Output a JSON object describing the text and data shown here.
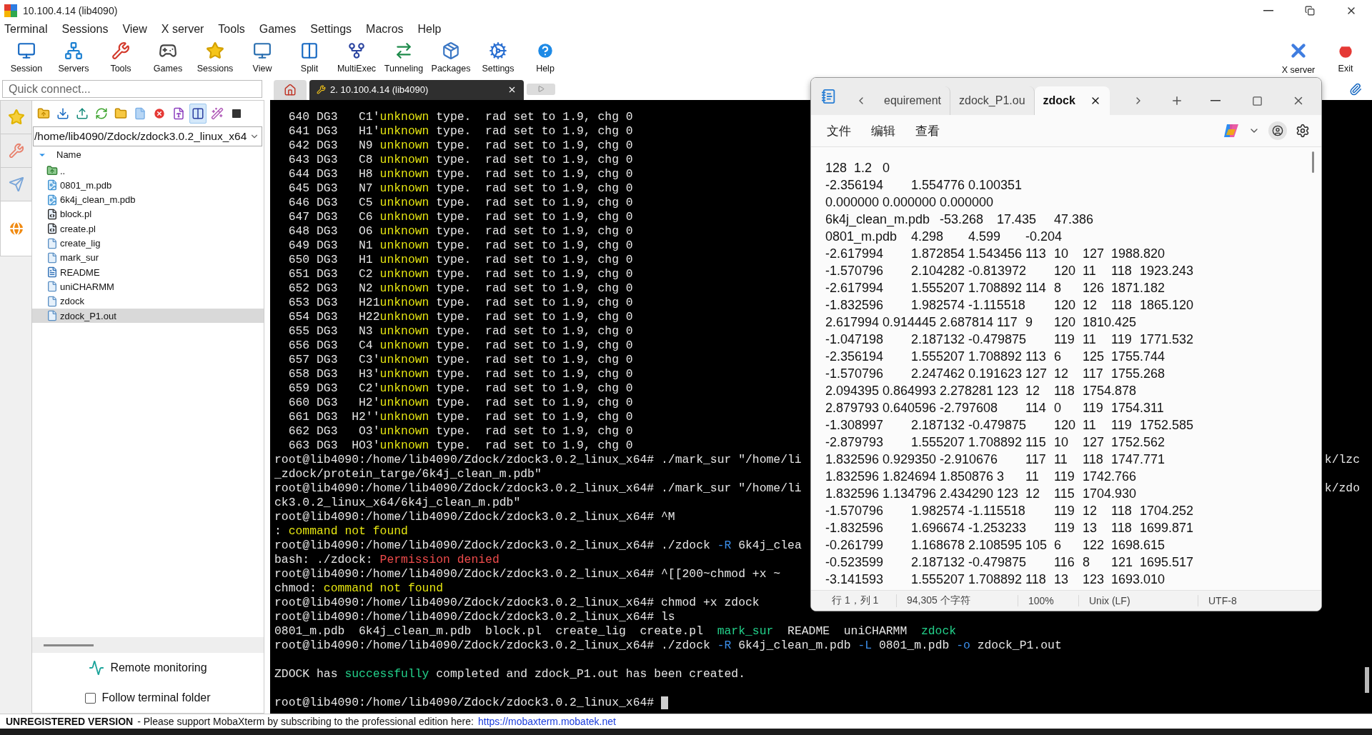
{
  "window": {
    "title": "10.100.4.14 (lib4090)"
  },
  "menu": [
    "Terminal",
    "Sessions",
    "View",
    "X server",
    "Tools",
    "Games",
    "Settings",
    "Macros",
    "Help"
  ],
  "toolbar": {
    "left": [
      "Session",
      "Servers",
      "Tools",
      "Games",
      "Sessions",
      "View",
      "Split",
      "MultiExec",
      "Tunneling",
      "Packages",
      "Settings",
      "Help"
    ],
    "right": [
      "X server",
      "Exit"
    ]
  },
  "quick_connect": {
    "placeholder": "Quick connect..."
  },
  "session_tabs": [
    {
      "kind": "home",
      "selected": false
    },
    {
      "kind": "session",
      "label": "2. 10.100.4.14 (lib4090)",
      "selected": true
    },
    {
      "kind": "new",
      "selected": false
    }
  ],
  "sidebar": {
    "tabs": [
      {
        "selected": false
      },
      {
        "selected": false
      },
      {
        "selected": false
      },
      {
        "selected": true
      }
    ],
    "toolbar": [
      {
        "selected": false
      },
      {
        "selected": false
      },
      {
        "selected": false
      },
      {
        "selected": false
      },
      {
        "selected": false
      },
      {
        "selected": false
      },
      {
        "selected": false
      },
      {
        "selected": false
      },
      {
        "selected": true
      },
      {
        "selected": false
      },
      {
        "selected": false
      }
    ],
    "path": "/home/lib4090/Zdock/zdock3.0.2_linux_x64",
    "column": "Name",
    "files": [
      {
        "name": "..",
        "kind": "parent",
        "selected": false
      },
      {
        "name": "0801_m.pdb",
        "kind": "pdb",
        "selected": false
      },
      {
        "name": "6k4j_clean_m.pdb",
        "kind": "pdb",
        "selected": false
      },
      {
        "name": "block.pl",
        "kind": "script",
        "selected": false
      },
      {
        "name": "create.pl",
        "kind": "script",
        "selected": false
      },
      {
        "name": "create_lig",
        "kind": "file",
        "selected": false
      },
      {
        "name": "mark_sur",
        "kind": "file",
        "selected": false
      },
      {
        "name": "README",
        "kind": "text",
        "selected": false
      },
      {
        "name": "uniCHARMM",
        "kind": "file",
        "selected": false
      },
      {
        "name": "zdock",
        "kind": "file",
        "selected": false
      },
      {
        "name": "zdock_P1.out",
        "kind": "file",
        "selected": true
      }
    ],
    "remote_monitoring": "Remote monitoring",
    "follow_terminal_folder": {
      "label": "Follow terminal folder",
      "checked": false
    }
  },
  "terminal": {
    "lines": [
      {
        "kind": "text",
        "parts": [
          {
            "text": "  640 DG3   C1'",
            "kind": "plain"
          },
          {
            "text": "unknown",
            "kind": "warning"
          },
          {
            "text": " type.  rad set to 1.9, chg 0",
            "kind": "plain"
          }
        ]
      },
      {
        "kind": "text",
        "parts": [
          {
            "text": "  641 DG3   H1'",
            "kind": "plain"
          },
          {
            "text": "unknown",
            "kind": "warning"
          },
          {
            "text": " type.  rad set to 1.9, chg 0",
            "kind": "plain"
          }
        ]
      },
      {
        "kind": "text",
        "parts": [
          {
            "text": "  642 DG3   N9 ",
            "kind": "plain"
          },
          {
            "text": "unknown",
            "kind": "warning"
          },
          {
            "text": " type.  rad set to 1.9, chg 0",
            "kind": "plain"
          }
        ]
      },
      {
        "kind": "text",
        "parts": [
          {
            "text": "  643 DG3   C8 ",
            "kind": "plain"
          },
          {
            "text": "unknown",
            "kind": "warning"
          },
          {
            "text": " type.  rad set to 1.9, chg 0",
            "kind": "plain"
          }
        ]
      },
      {
        "kind": "text",
        "parts": [
          {
            "text": "  644 DG3   H8 ",
            "kind": "plain"
          },
          {
            "text": "unknown",
            "kind": "warning"
          },
          {
            "text": " type.  rad set to 1.9, chg 0",
            "kind": "plain"
          }
        ]
      },
      {
        "kind": "text",
        "parts": [
          {
            "text": "  645 DG3   N7 ",
            "kind": "plain"
          },
          {
            "text": "unknown",
            "kind": "warning"
          },
          {
            "text": " type.  rad set to 1.9, chg 0",
            "kind": "plain"
          }
        ]
      },
      {
        "kind": "text",
        "parts": [
          {
            "text": "  646 DG3   C5 ",
            "kind": "plain"
          },
          {
            "text": "unknown",
            "kind": "warning"
          },
          {
            "text": " type.  rad set to 1.9, chg 0",
            "kind": "plain"
          }
        ]
      },
      {
        "kind": "text",
        "parts": [
          {
            "text": "  647 DG3   C6 ",
            "kind": "plain"
          },
          {
            "text": "unknown",
            "kind": "warning"
          },
          {
            "text": " type.  rad set to 1.9, chg 0",
            "kind": "plain"
          }
        ]
      },
      {
        "kind": "text",
        "parts": [
          {
            "text": "  648 DG3   O6 ",
            "kind": "plain"
          },
          {
            "text": "unknown",
            "kind": "warning"
          },
          {
            "text": " type.  rad set to 1.9, chg 0",
            "kind": "plain"
          }
        ]
      },
      {
        "kind": "text",
        "parts": [
          {
            "text": "  649 DG3   N1 ",
            "kind": "plain"
          },
          {
            "text": "unknown",
            "kind": "warning"
          },
          {
            "text": " type.  rad set to 1.9, chg 0",
            "kind": "plain"
          }
        ]
      },
      {
        "kind": "text",
        "parts": [
          {
            "text": "  650 DG3   H1 ",
            "kind": "plain"
          },
          {
            "text": "unknown",
            "kind": "warning"
          },
          {
            "text": " type.  rad set to 1.9, chg 0",
            "kind": "plain"
          }
        ]
      },
      {
        "kind": "text",
        "parts": [
          {
            "text": "  651 DG3   C2 ",
            "kind": "plain"
          },
          {
            "text": "unknown",
            "kind": "warning"
          },
          {
            "text": " type.  rad set to 1.9, chg 0",
            "kind": "plain"
          }
        ]
      },
      {
        "kind": "text",
        "parts": [
          {
            "text": "  652 DG3   N2 ",
            "kind": "plain"
          },
          {
            "text": "unknown",
            "kind": "warning"
          },
          {
            "text": " type.  rad set to 1.9, chg 0",
            "kind": "plain"
          }
        ]
      },
      {
        "kind": "text",
        "parts": [
          {
            "text": "  653 DG3   H21",
            "kind": "plain"
          },
          {
            "text": "unknown",
            "kind": "warning"
          },
          {
            "text": " type.  rad set to 1.9, chg 0",
            "kind": "plain"
          }
        ]
      },
      {
        "kind": "text",
        "parts": [
          {
            "text": "  654 DG3   H22",
            "kind": "plain"
          },
          {
            "text": "unknown",
            "kind": "warning"
          },
          {
            "text": " type.  rad set to 1.9, chg 0",
            "kind": "plain"
          }
        ]
      },
      {
        "kind": "text",
        "parts": [
          {
            "text": "  655 DG3   N3 ",
            "kind": "plain"
          },
          {
            "text": "unknown",
            "kind": "warning"
          },
          {
            "text": " type.  rad set to 1.9, chg 0",
            "kind": "plain"
          }
        ]
      },
      {
        "kind": "text",
        "parts": [
          {
            "text": "  656 DG3   C4 ",
            "kind": "plain"
          },
          {
            "text": "unknown",
            "kind": "warning"
          },
          {
            "text": " type.  rad set to 1.9, chg 0",
            "kind": "plain"
          }
        ]
      },
      {
        "kind": "text",
        "parts": [
          {
            "text": "  657 DG3   C3'",
            "kind": "plain"
          },
          {
            "text": "unknown",
            "kind": "warning"
          },
          {
            "text": " type.  rad set to 1.9, chg 0",
            "kind": "plain"
          }
        ]
      },
      {
        "kind": "text",
        "parts": [
          {
            "text": "  658 DG3   H3'",
            "kind": "plain"
          },
          {
            "text": "unknown",
            "kind": "warning"
          },
          {
            "text": " type.  rad set to 1.9, chg 0",
            "kind": "plain"
          }
        ]
      },
      {
        "kind": "text",
        "parts": [
          {
            "text": "  659 DG3   C2'",
            "kind": "plain"
          },
          {
            "text": "unknown",
            "kind": "warning"
          },
          {
            "text": " type.  rad set to 1.9, chg 0",
            "kind": "plain"
          }
        ]
      },
      {
        "kind": "text",
        "parts": [
          {
            "text": "  660 DG3   H2'",
            "kind": "plain"
          },
          {
            "text": "unknown",
            "kind": "warning"
          },
          {
            "text": " type.  rad set to 1.9, chg 0",
            "kind": "plain"
          }
        ]
      },
      {
        "kind": "text",
        "parts": [
          {
            "text": "  661 DG3  H2''",
            "kind": "plain"
          },
          {
            "text": "unknown",
            "kind": "warning"
          },
          {
            "text": " type.  rad set to 1.9, chg 0",
            "kind": "plain"
          }
        ]
      },
      {
        "kind": "text",
        "parts": [
          {
            "text": "  662 DG3   O3'",
            "kind": "plain"
          },
          {
            "text": "unknown",
            "kind": "warning"
          },
          {
            "text": " type.  rad set to 1.9, chg 0",
            "kind": "plain"
          }
        ]
      },
      {
        "kind": "text",
        "parts": [
          {
            "text": "  663 DG3  HO3'",
            "kind": "plain"
          },
          {
            "text": "unknown",
            "kind": "warning"
          },
          {
            "text": " type.  rad set to 1.9, chg 0",
            "kind": "plain"
          }
        ]
      },
      {
        "kind": "text",
        "parts": [
          {
            "text": "root@lib4090:/home/lib4090/Zdock/zdock3.0.2_linux_x64# ./mark_sur \"/home/li",
            "kind": "plain"
          }
        ],
        "right": "k/lzc"
      },
      {
        "kind": "text",
        "parts": [
          {
            "text": "_zdock/protein_targe/6k4j_clean_m.pdb\"",
            "kind": "plain"
          }
        ]
      },
      {
        "kind": "text",
        "parts": [
          {
            "text": "root@lib4090:/home/lib4090/Zdock/zdock3.0.2_linux_x64# ./mark_sur \"/home/li",
            "kind": "plain"
          }
        ],
        "right": "k/zdo"
      },
      {
        "kind": "text",
        "parts": [
          {
            "text": "ck3.0.2_linux_x64/6k4j_clean_m.pdb\"",
            "kind": "plain"
          }
        ]
      },
      {
        "kind": "text",
        "parts": [
          {
            "text": "root@lib4090:/home/lib4090/Zdock/zdock3.0.2_linux_x64# ^M",
            "kind": "plain"
          }
        ]
      },
      {
        "kind": "text",
        "parts": [
          {
            "text": ": ",
            "kind": "plain"
          },
          {
            "text": "command not found",
            "kind": "warning"
          }
        ]
      },
      {
        "kind": "text",
        "parts": [
          {
            "text": "root@lib4090:/home/lib4090/Zdock/zdock3.0.2_linux_x64# ./zdock ",
            "kind": "plain"
          },
          {
            "text": "-R",
            "kind": "option"
          },
          {
            "text": " 6k4j_clea",
            "kind": "plain"
          }
        ]
      },
      {
        "kind": "text",
        "parts": [
          {
            "text": "bash: ./zdock: ",
            "kind": "plain"
          },
          {
            "text": "Permission denied",
            "kind": "error"
          }
        ]
      },
      {
        "kind": "text",
        "parts": [
          {
            "text": "root@lib4090:/home/lib4090/Zdock/zdock3.0.2_linux_x64# ^[[200~chmod +x ~",
            "kind": "plain"
          }
        ]
      },
      {
        "kind": "text",
        "parts": [
          {
            "text": "chmod: ",
            "kind": "plain"
          },
          {
            "text": "command not found",
            "kind": "warning"
          }
        ]
      },
      {
        "kind": "text",
        "parts": [
          {
            "text": "root@lib4090:/home/lib4090/Zdock/zdock3.0.2_linux_x64# chmod +x zdock",
            "kind": "plain"
          }
        ]
      },
      {
        "kind": "text",
        "parts": [
          {
            "text": "root@lib4090:/home/lib4090/Zdock/zdock3.0.2_linux_x64# ls",
            "kind": "plain"
          }
        ]
      },
      {
        "kind": "text",
        "parts": [
          {
            "text": "0801_m.pdb  6k4j_clean_m.pdb  block.pl  create_lig  create.pl  ",
            "kind": "plain"
          },
          {
            "text": "mark_sur",
            "kind": "executable"
          },
          {
            "text": "  README  uniCHARMM  ",
            "kind": "plain"
          },
          {
            "text": "zdock",
            "kind": "executable"
          }
        ]
      },
      {
        "kind": "text",
        "parts": [
          {
            "text": "root@lib4090:/home/lib4090/Zdock/zdock3.0.2_linux_x64# ./zdock ",
            "kind": "plain"
          },
          {
            "text": "-R",
            "kind": "option"
          },
          {
            "text": " 6k4j_clean_m.pdb ",
            "kind": "plain"
          },
          {
            "text": "-L",
            "kind": "option"
          },
          {
            "text": " 0801_m.pdb ",
            "kind": "plain"
          },
          {
            "text": "-o",
            "kind": "option"
          },
          {
            "text": " zdock_P1.out",
            "kind": "plain"
          }
        ]
      },
      {
        "kind": "blank"
      },
      {
        "kind": "text",
        "parts": [
          {
            "text": "ZDOCK has ",
            "kind": "plain"
          },
          {
            "text": "successfully",
            "kind": "success"
          },
          {
            "text": " completed and zdock_P1.out has been created.",
            "kind": "plain"
          }
        ]
      },
      {
        "kind": "blank"
      },
      {
        "kind": "text",
        "parts": [
          {
            "text": "root@lib4090:/home/lib4090/Zdock/zdock3.0.2_linux_x64# ",
            "kind": "plain"
          }
        ],
        "cursor": true
      }
    ]
  },
  "notepad": {
    "tabs": [
      {
        "label": "equirement",
        "selected": false
      },
      {
        "label": "zdock_P1.ou",
        "selected": false
      },
      {
        "label": "zdock",
        "selected": true
      }
    ],
    "menu": [
      "文件",
      "编辑",
      "查看"
    ],
    "lines": [
      "128\t1.2\t0",
      "-2.356194\t1.554776\t0.100351",
      "0.000000\t0.000000\t0.000000",
      "6k4j_clean_m.pdb\t-53.268\t17.435\t47.386",
      "0801_m.pdb\t4.298\t4.599\t-0.204",
      "-2.617994\t1.872854\t1.543456\t113\t10\t127\t1988.820",
      "-1.570796\t2.104282\t-0.813972\t120\t11\t118\t1923.243",
      "-2.617994\t1.555207\t1.708892\t114\t8\t126\t1871.182",
      "-1.832596\t1.982574\t-1.115518\t120\t12\t118\t1865.120",
      "2.617994\t0.914445\t2.687814\t117\t9\t120\t1810.425",
      "-1.047198\t2.187132\t-0.479875\t119\t11\t119\t1771.532",
      "-2.356194\t1.555207\t1.708892\t113\t6\t125\t1755.744",
      "-1.570796\t2.247462\t0.191623\t127\t12\t117\t1755.268",
      "2.094395\t0.864993\t2.278281\t123\t12\t118\t1754.878",
      "2.879793\t0.640596\t-2.797608\t114\t0\t119\t1754.311",
      "-1.308997\t2.187132\t-0.479875\t120\t11\t119\t1752.585",
      "-2.879793\t1.555207\t1.708892\t115\t10\t127\t1752.562",
      "1.832596\t0.929350\t-2.910676\t117\t11\t118\t1747.771",
      "1.832596\t1.824694\t1.850876\t3\t11\t119\t1742.766",
      "1.832596\t1.134796\t2.434290\t123\t12\t115\t1704.930",
      "-1.570796\t1.982574\t-1.115518\t119\t12\t118\t1704.252",
      "-1.832596\t1.696674\t-1.253233\t119\t13\t118\t1699.871",
      "-0.261799\t1.168678\t2.108595\t105\t6\t122\t1698.615",
      "-0.523599\t2.187132\t-0.479875\t116\t8\t121\t1695.517",
      "-3.141593\t1.555207\t1.708892\t118\t13\t123\t1693.010"
    ],
    "status": [
      "行 1，列 1",
      "94,305 个字符",
      "100%",
      "Unix (LF)",
      "UTF-8"
    ]
  },
  "status_bar": {
    "notice": "UNREGISTERED VERSION",
    "message": "-  Please support MobaXterm by subscribing to the professional edition here:",
    "link": "https://mobaxterm.mobatek.net"
  }
}
